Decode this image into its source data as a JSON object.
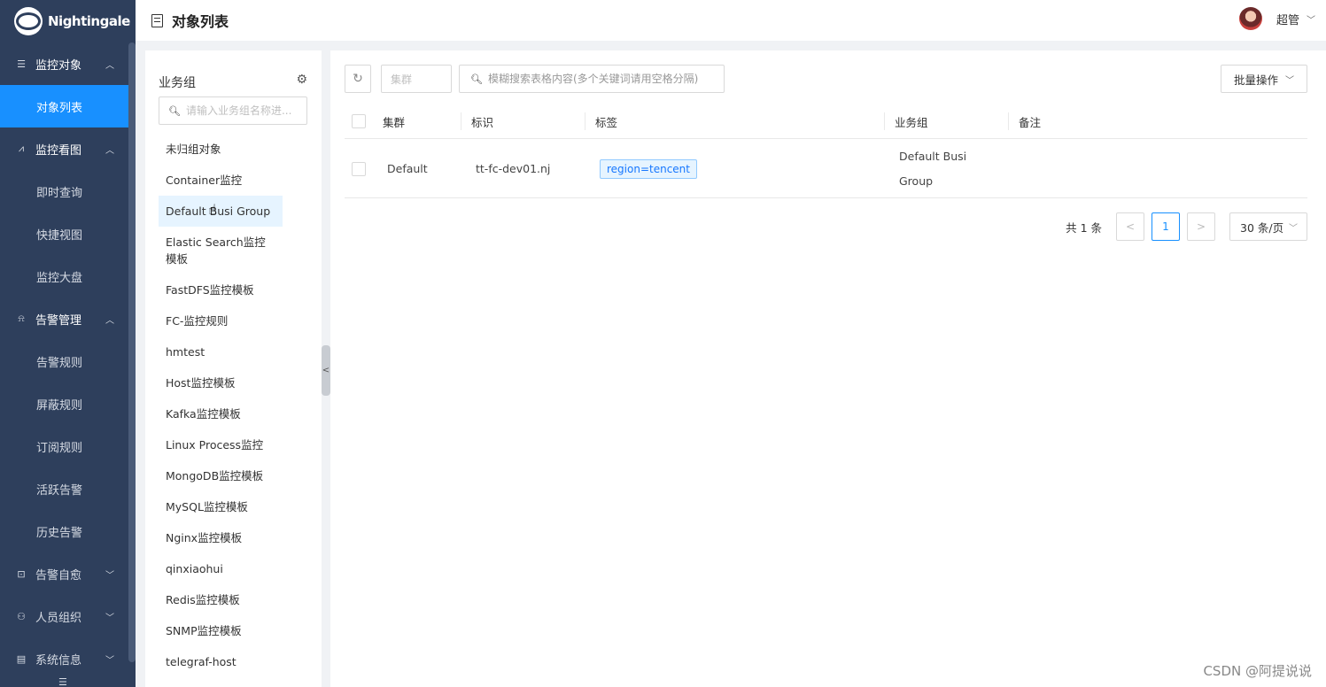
{
  "sidebar": {
    "logo_text": "Nightingale",
    "groups": [
      {
        "label": "监控对象",
        "icon": "list-icon",
        "expanded": true,
        "items": [
          {
            "label": "对象列表",
            "active": true
          }
        ]
      },
      {
        "label": "监控看图",
        "icon": "line-chart-icon",
        "expanded": true,
        "items": [
          {
            "label": "即时查询"
          },
          {
            "label": "快捷视图"
          },
          {
            "label": "监控大盘"
          }
        ]
      },
      {
        "label": "告警管理",
        "icon": "alarm-icon",
        "expanded": true,
        "items": [
          {
            "label": "告警规则"
          },
          {
            "label": "屏蔽规则"
          },
          {
            "label": "订阅规则"
          },
          {
            "label": "活跃告警"
          },
          {
            "label": "历史告警"
          }
        ]
      },
      {
        "label": "告警自愈",
        "icon": "code-icon",
        "expanded": false,
        "items": []
      },
      {
        "label": "人员组织",
        "icon": "user-icon",
        "expanded": false,
        "items": []
      },
      {
        "label": "系统信息",
        "icon": "info-icon",
        "expanded": false,
        "items": []
      }
    ]
  },
  "header": {
    "title": "对象列表",
    "user_name": "超管"
  },
  "group_panel": {
    "title": "业务组",
    "search_placeholder": "请输入业务组名称进...",
    "items": [
      "未归组对象",
      "Container监控",
      "Default Busi Group",
      "Elastic Search监控模板",
      "FastDFS监控模板",
      "FC-监控规则",
      "hmtest",
      "Host监控模板",
      "Kafka监控模板",
      "Linux Process监控",
      "MongoDB监控模板",
      "MySQL监控模板",
      "Nginx监控模板",
      "qinxiaohui",
      "Redis监控模板",
      "SNMP监控模板",
      "telegraf-host"
    ],
    "selected_index": 2
  },
  "toolbar": {
    "cluster_placeholder": "集群",
    "search_placeholder": "模糊搜索表格内容(多个关键词请用空格分隔)",
    "batch_label": "批量操作"
  },
  "table": {
    "columns": [
      "集群",
      "标识",
      "标签",
      "业务组",
      "备注"
    ],
    "rows": [
      {
        "cluster": "Default",
        "ident": "tt-fc-dev01.nj",
        "tag": "region=tencent",
        "group_line1": "Default Busi",
        "group_line2": "Group",
        "note": ""
      }
    ]
  },
  "pagination": {
    "total": "共 1 条",
    "current_page": "1",
    "page_size": "30 条/页"
  },
  "watermark": "CSDN @阿提说说",
  "colors": {
    "sidebar_bg": "#2e3f5c",
    "accent": "#1890ff",
    "tag_bg": "#e6f4ff",
    "tag_border": "#91caff"
  }
}
